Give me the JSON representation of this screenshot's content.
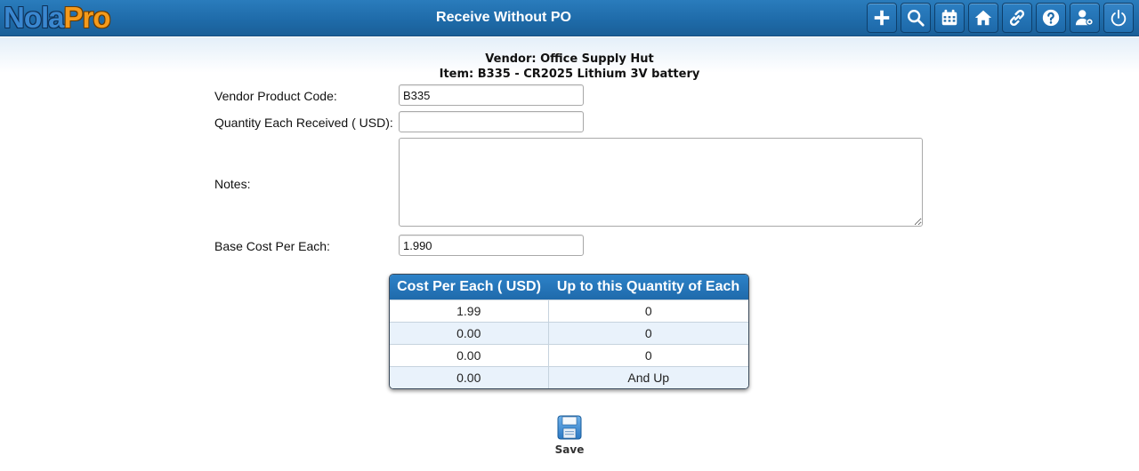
{
  "app": {
    "logo_part1": "Nola",
    "logo_part2": "Pro",
    "title": "Receive Without PO"
  },
  "toolbar": [
    {
      "name": "add-icon"
    },
    {
      "name": "search-icon"
    },
    {
      "name": "calendar-icon"
    },
    {
      "name": "home-icon"
    },
    {
      "name": "link-icon"
    },
    {
      "name": "help-icon"
    },
    {
      "name": "user-settings-icon"
    },
    {
      "name": "power-icon"
    }
  ],
  "header": {
    "vendor": "Vendor: Office Supply Hut",
    "item": "Item: B335 - CR2025 Lithium 3V battery"
  },
  "form": {
    "vendor_product_code_label": "Vendor Product Code:",
    "vendor_product_code_value": "B335",
    "quantity_label": "Quantity Each Received ( USD):",
    "quantity_value": "",
    "notes_label": "Notes:",
    "notes_value": "",
    "base_cost_label": "Base Cost Per Each:",
    "base_cost_value": "1.990"
  },
  "pricing_table": {
    "headers": [
      "Cost Per Each ( USD)",
      "Up to this Quantity of Each"
    ],
    "rows": [
      [
        "1.99",
        "0"
      ],
      [
        "0.00",
        "0"
      ],
      [
        "0.00",
        "0"
      ],
      [
        "0.00",
        "And Up"
      ]
    ]
  },
  "actions": {
    "save_label": "Save"
  },
  "colors": {
    "header_blue": "#1e6aa8",
    "accent_orange": "#f59a1b",
    "alt_row": "#e9f2fb"
  }
}
